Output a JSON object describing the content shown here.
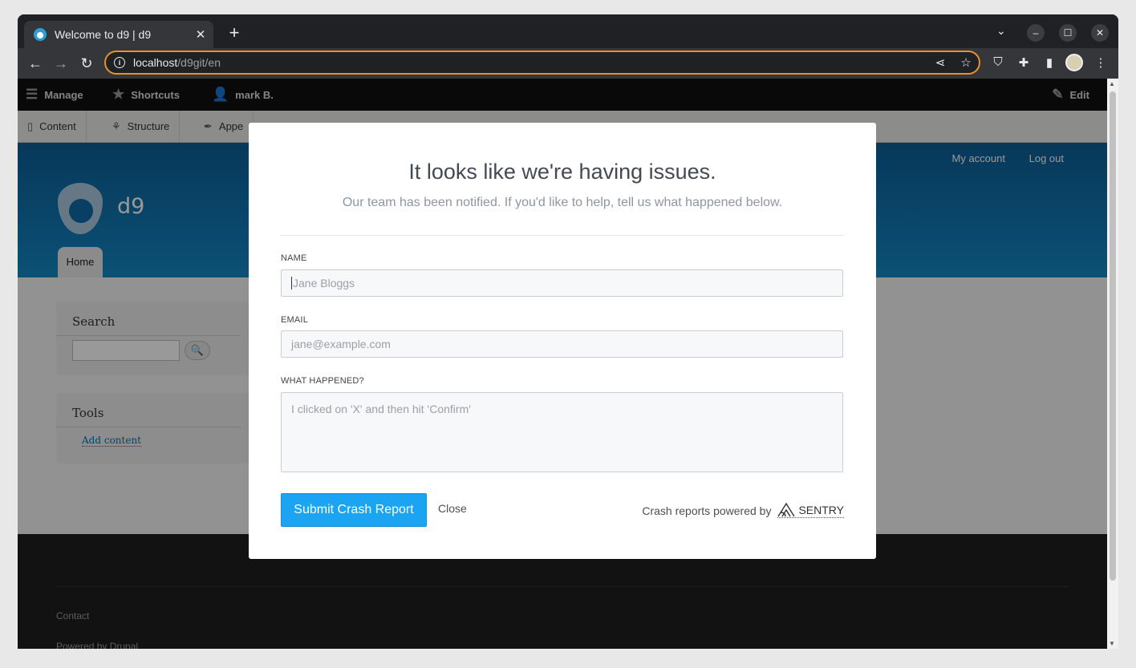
{
  "browser": {
    "tab_title": "Welcome to d9 | d9",
    "tab_close": "✕",
    "new_tab": "+",
    "tab_menu": "⌄",
    "url_host": "localhost",
    "url_path": "/d9git/en",
    "info_glyph": "i",
    "icons": [
      "back-arrow-icon",
      "forward-arrow-icon",
      "reload-icon",
      "share-icon",
      "star-icon",
      "ublock-icon",
      "extensions-icon",
      "sidepanel-icon",
      "profile-avatar-icon",
      "kebab-menu-icon"
    ],
    "win_min": "–",
    "win_max": "☐",
    "win_close": "✕"
  },
  "admin_toolbar": {
    "manage": "Manage",
    "shortcuts": "Shortcuts",
    "user": "mark B.",
    "edit": "Edit",
    "tray": [
      "Content",
      "Structure",
      "Appe"
    ]
  },
  "site": {
    "name": "d9",
    "my_account": "My account",
    "log_out": "Log out",
    "home_tab": "Home",
    "search_title": "Search",
    "tools_title": "Tools",
    "add_content": "Add content",
    "footer_contact": "Contact",
    "footer_powered": "Powered by Drupal"
  },
  "dialog": {
    "title": "It looks like we're having issues.",
    "subtitle": "Our team has been notified. If you'd like to help, tell us what happened below.",
    "name_label": "NAME",
    "name_placeholder": "Jane Bloggs",
    "email_label": "EMAIL",
    "email_placeholder": "jane@example.com",
    "what_label": "WHAT HAPPENED?",
    "what_placeholder": "I clicked on 'X' and then hit 'Confirm'",
    "submit": "Submit Crash Report",
    "close": "Close",
    "powered_by": "Crash reports powered by",
    "sentry": "SENTRY",
    "accent_color": "#1ba4f2"
  }
}
